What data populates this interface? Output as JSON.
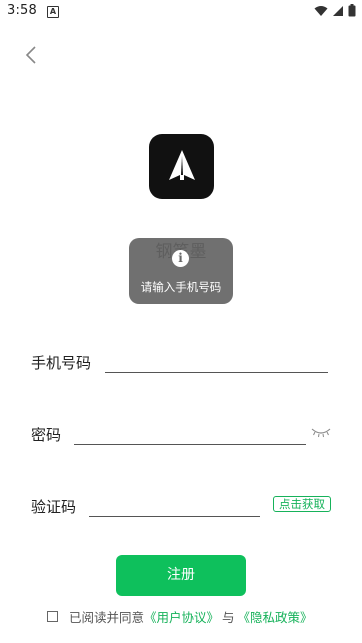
{
  "status_bar": {
    "time": "3:58",
    "notification_icon": "A"
  },
  "header": {
    "back_icon": "chevron-left-icon"
  },
  "app": {
    "name": "钢笔墨",
    "logo_icon": "pen-nib-logo"
  },
  "toast": {
    "icon": "i",
    "message": "请输入手机号码"
  },
  "form": {
    "phone_label": "手机号码",
    "phone_value": "",
    "password_label": "密码",
    "password_value": "",
    "code_label": "验证码",
    "code_value": "",
    "get_code_button": "点击获取"
  },
  "register_button": "注册",
  "agreement": {
    "prefix": "已阅读并同意",
    "user_agreement": "《用户协议》",
    "and": "与",
    "privacy_policy": "《隐私政策》",
    "checked": false
  },
  "colors": {
    "accent": "#0ec05c",
    "link": "#16b25a",
    "toast_bg": "#646464"
  }
}
